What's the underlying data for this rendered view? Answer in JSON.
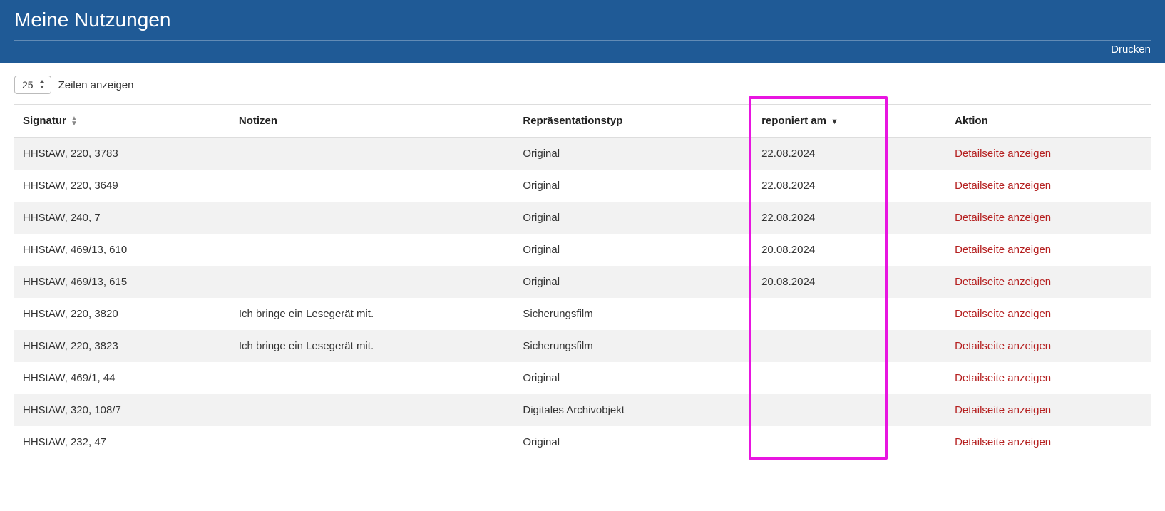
{
  "header": {
    "title": "Meine Nutzungen",
    "print_label": "Drucken"
  },
  "rowsControl": {
    "selected": "25",
    "label": "Zeilen anzeigen"
  },
  "columns": {
    "signatur": "Signatur",
    "notizen": "Notizen",
    "repraesentationstyp": "Repräsentationstyp",
    "reponiert_am": "reponiert am",
    "aktion": "Aktion"
  },
  "action_link_label": "Detailseite anzeigen",
  "rows": [
    {
      "signatur": "HHStAW, 220, 3783",
      "notizen": "",
      "rep": "Original",
      "date": "22.08.2024"
    },
    {
      "signatur": "HHStAW, 220, 3649",
      "notizen": "",
      "rep": "Original",
      "date": "22.08.2024"
    },
    {
      "signatur": "HHStAW, 240, 7",
      "notizen": "",
      "rep": "Original",
      "date": "22.08.2024"
    },
    {
      "signatur": "HHStAW, 469/13, 610",
      "notizen": "",
      "rep": "Original",
      "date": "20.08.2024"
    },
    {
      "signatur": "HHStAW, 469/13, 615",
      "notizen": "",
      "rep": "Original",
      "date": "20.08.2024"
    },
    {
      "signatur": "HHStAW, 220, 3820",
      "notizen": "Ich bringe ein Lesegerät mit.",
      "rep": "Sicherungsfilm",
      "date": ""
    },
    {
      "signatur": "HHStAW, 220, 3823",
      "notizen": "Ich bringe ein Lesegerät mit.",
      "rep": "Sicherungsfilm",
      "date": ""
    },
    {
      "signatur": "HHStAW, 469/1, 44",
      "notizen": "",
      "rep": "Original",
      "date": ""
    },
    {
      "signatur": "HHStAW, 320, 108/7",
      "notizen": "",
      "rep": "Digitales Archivobjekt",
      "date": ""
    },
    {
      "signatur": "HHStAW, 232, 47",
      "notizen": "",
      "rep": "Original",
      "date": ""
    }
  ]
}
